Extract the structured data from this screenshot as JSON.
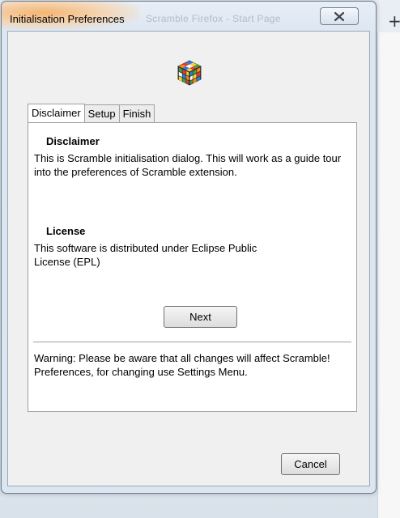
{
  "window": {
    "title": "Initialisation Preferences",
    "background_title": "Scramble Firefox - Start Page",
    "close_icon": "close-icon",
    "logo_icon": "rubiks-cube-icon"
  },
  "tabs": [
    {
      "label": "Disclaimer",
      "active": true
    },
    {
      "label": "Setup",
      "active": false
    },
    {
      "label": "Finish",
      "active": false
    }
  ],
  "disclaimer": {
    "heading": "Disclaimer",
    "text": "This is Scramble initialisation dialog. This will work as a guide tour into the preferences of Scramble extension."
  },
  "license": {
    "heading": "License",
    "text": "This software is distributed under Eclipse Public License (EPL)"
  },
  "next_label": "Next",
  "warning": "Warning: Please be aware that all changes will affect Scramble! Preferences, for changing use Settings Menu.",
  "cancel_label": "Cancel",
  "background": {
    "new_tab_glyph": "+"
  },
  "colors": {
    "title_glow": "#f6b26b",
    "window_border": "#6e7e92",
    "client_bg": "#f0f0f0",
    "panel_bg": "#ffffff"
  }
}
